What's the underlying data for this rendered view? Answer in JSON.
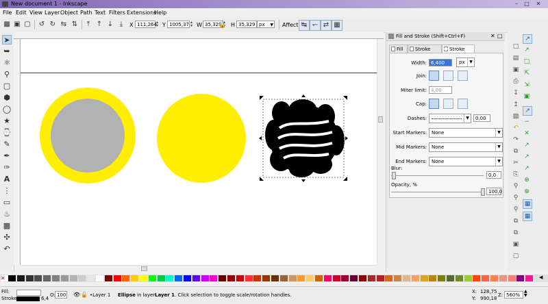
{
  "window": {
    "title": "New document 1 - Inkscape"
  },
  "menu": [
    "File",
    "Edit",
    "View",
    "Layer",
    "Object",
    "Path",
    "Text",
    "Filters",
    "Extensions",
    "Help"
  ],
  "toolbar": {
    "x_label": "X",
    "x_value": "111,264",
    "y_label": "Y",
    "y_value": "1005,37",
    "w_label": "W",
    "w_value": "35,329",
    "h_label": "H",
    "h_value": "35,329",
    "unit": "px",
    "affect_label": "Affect:"
  },
  "panel": {
    "title": "Fill and Stroke (Shift+Ctrl+F)",
    "tabs": [
      "Fill",
      "Stroke paint",
      "Stroke style"
    ],
    "active_tab": "Stroke style",
    "width_label": "Width:",
    "width_value": "6,400",
    "width_unit": "px",
    "join_label": "Join:",
    "miter_label": "Miter limit:",
    "miter_value": "4,00",
    "cap_label": "Cap:",
    "dashes_label": "Dashes:",
    "dashes_value": "0,00",
    "start_markers_label": "Start Markers:",
    "start_markers_value": "None",
    "mid_markers_label": "Mid Markers:",
    "mid_markers_value": "None",
    "end_markers_label": "End Markers:",
    "end_markers_value": "None",
    "blur_label": "Blur:",
    "blur_value": "0,0",
    "opacity_label": "Opacity, %",
    "opacity_value": "100,0"
  },
  "status": {
    "fill_label": "Fill:",
    "stroke_label": "Stroke:",
    "stroke_width": "6,4",
    "opacity_label": "O:",
    "opacity_value": "100",
    "layer": "•Layer 1",
    "message_bold": "Ellipse",
    "message_mid": " in layer ",
    "message_layer": "Layer 1",
    "message_rest": ". Click selection to toggle scale/rotation handles.",
    "x_label": "X:",
    "x_value": "128,75",
    "y_label": "Y:",
    "y_value": "990,18",
    "z_label": "Z:",
    "zoom": "560%"
  },
  "colors": {
    "yellow": "#ffee00",
    "grey": "#b2b2b2",
    "black": "#000000",
    "palette": [
      "#000000",
      "#1a1a1a",
      "#333333",
      "#4d4d4d",
      "#666666",
      "#808080",
      "#999999",
      "#b3b3b3",
      "#cccccc",
      "#e6e6e6",
      "#ffffff",
      "#800000",
      "#ff0000",
      "#ff6600",
      "#ffcc00",
      "#ffff00",
      "#00ff00",
      "#00cc44",
      "#00ffcc",
      "#0066ff",
      "#0000ff",
      "#6600ff",
      "#cc00ff",
      "#ff00cc",
      "#660000",
      "#990000",
      "#cc0000",
      "#ff3333",
      "#cc3300",
      "#993300",
      "#663300",
      "#996633",
      "#cc9966",
      "#ff9933",
      "#ffcc66",
      "#cc6600",
      "#ff0066",
      "#cc0033",
      "#990033",
      "#660033",
      "#8b0000",
      "#a52a2a",
      "#b22222",
      "#d2691e",
      "#cd853f",
      "#deb887",
      "#f4a460",
      "#daa520",
      "#b8860b",
      "#808000",
      "#556b2f",
      "#6b8e23",
      "#9acd32",
      "#ff4500",
      "#ff6347",
      "#ff7f50",
      "#e9967a",
      "#fa8072",
      "#800080",
      "#ff1493"
    ]
  }
}
